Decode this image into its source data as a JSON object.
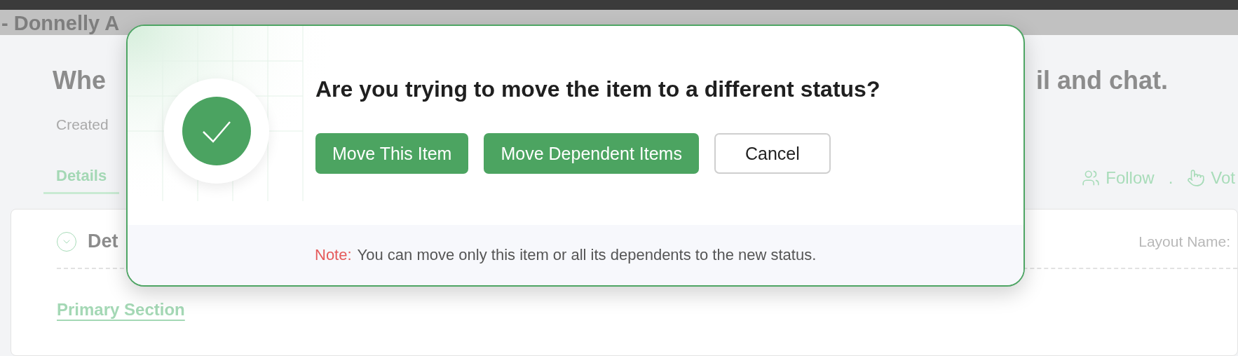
{
  "header": {
    "title": "- Donnelly A"
  },
  "page": {
    "title_start": "Whe",
    "title_end": "il and chat.",
    "created": "Created",
    "tabs": [
      {
        "label": "Details",
        "selected": true
      }
    ],
    "actions": [
      {
        "kind": "follow",
        "label": "Follow"
      },
      {
        "kind": "separator",
        "label": "."
      },
      {
        "kind": "vote",
        "label": "Vot"
      }
    ]
  },
  "card": {
    "section_title": "Det",
    "layout_label": "Layout Name:",
    "link": "Primary Section"
  },
  "dialog": {
    "title": "Are you trying to move the item to a different status?",
    "buttons": [
      {
        "label": "Move This Item",
        "kind": "primary"
      },
      {
        "label": "Move Dependent Items",
        "kind": "primary"
      },
      {
        "label": "Cancel",
        "kind": "secondary"
      }
    ],
    "note_label": "Note:",
    "note": "You can move only this item or all its dependents to the new status."
  }
}
